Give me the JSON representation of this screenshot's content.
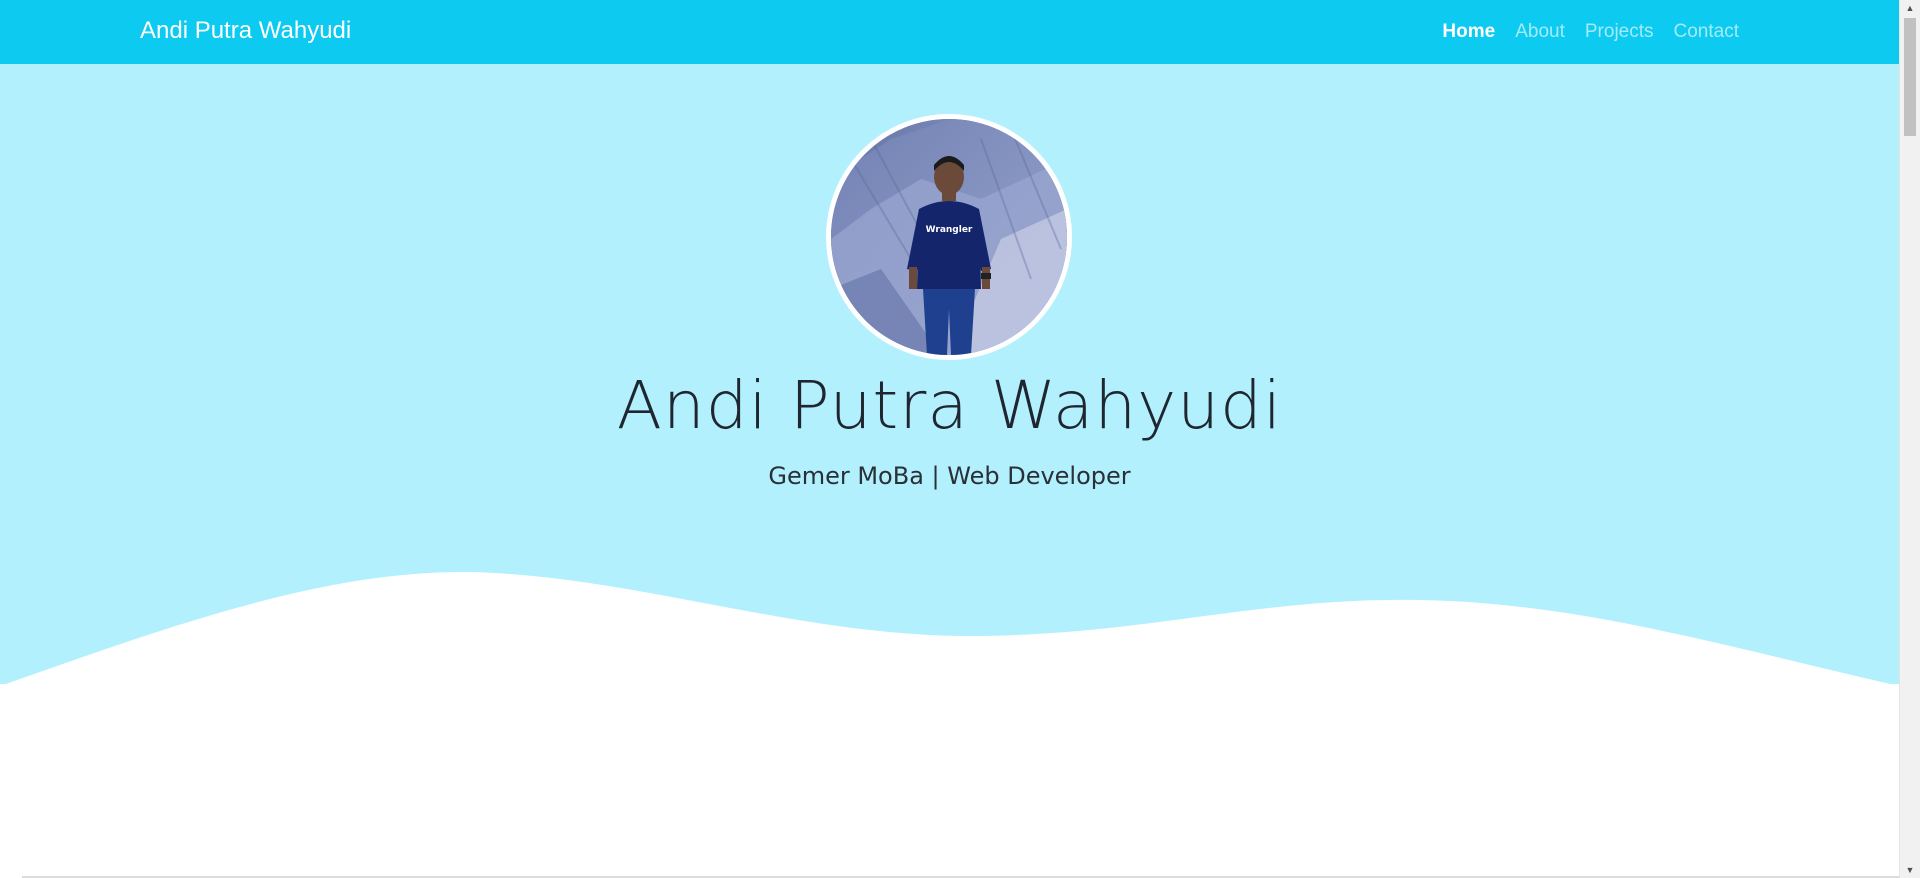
{
  "navbar": {
    "brand": "Andi Putra Wahyudi",
    "links": [
      {
        "label": "Home",
        "active": true
      },
      {
        "label": "About",
        "active": false
      },
      {
        "label": "Projects",
        "active": false
      },
      {
        "label": "Contact",
        "active": false
      }
    ]
  },
  "hero": {
    "name": "Andi Putra Wahyudi",
    "tagline": "Gemer MoBa | Web Developer",
    "shirt_text": "Wrangler"
  },
  "colors": {
    "navbar_bg": "#0dcaf0",
    "hero_bg": "#b2f0fd",
    "wave_fill": "#ffffff"
  },
  "icons": {
    "scroll_up": "triangle-up-icon",
    "scroll_down": "triangle-down-icon"
  }
}
